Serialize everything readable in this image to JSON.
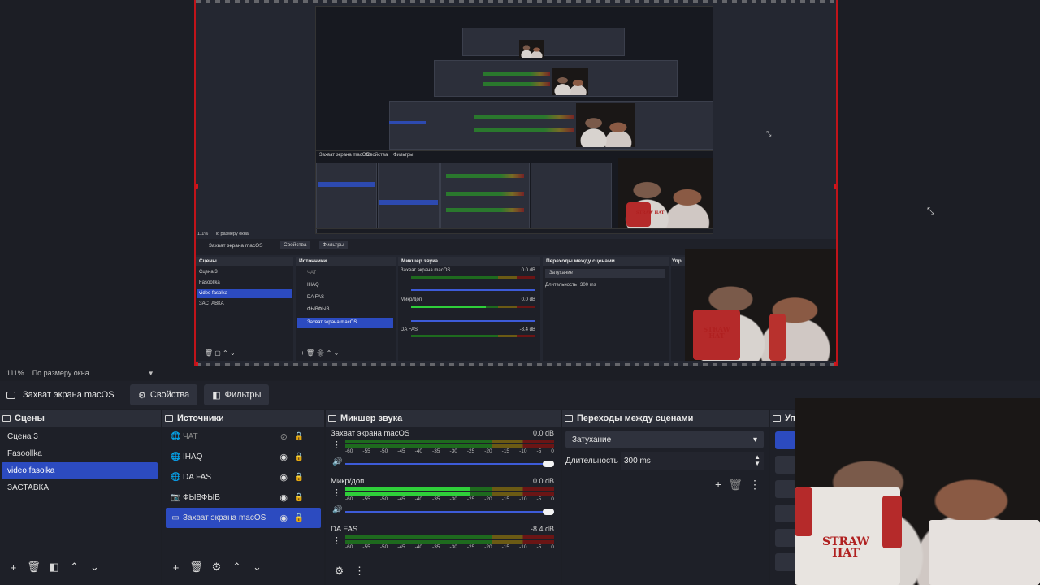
{
  "preview": {
    "nested_zoom": "111%",
    "nested_fit": "По размеру окна",
    "nested_source": "Захват экрана macOS",
    "nested_props": "Свойства",
    "nested_filters": "Фильтры",
    "nested_scenes_title": "Сцены",
    "nested_sources_title": "Источники",
    "nested_mixer_title": "Микшер звука",
    "nested_trans_title": "Переходы между сценами",
    "nested_scenes": [
      "Сцена 3",
      "Fasoollka",
      "video fasolka",
      "ЗАСТАВКА"
    ],
    "nested_sources": [
      "ЧАТ",
      "IHAQ",
      "DA FAS",
      "ФЫВФЫВ",
      "Захват экрана macOS"
    ],
    "nested_channels": [
      "Захват экрана macOS",
      "Микр/доп",
      "DA FAS"
    ],
    "nested_db": [
      "0.0 dB",
      "0.0 dB",
      "-8.4 dB"
    ],
    "nested_fade": "Затухание",
    "nested_duration_label": "Длительность",
    "nested_duration": "300 ms",
    "nested_controls_title": "Упр"
  },
  "statusbar": {
    "zoom": "111%",
    "fit_mode": "По размеру окна"
  },
  "source_toolbar": {
    "source_name": "Захват экрана macOS",
    "properties_label": "Свойства",
    "filters_label": "Фильтры"
  },
  "scenes": {
    "title": "Сцены",
    "items": [
      {
        "label": "Сцена 3",
        "selected": false
      },
      {
        "label": "Fasoollka",
        "selected": false
      },
      {
        "label": "video fasolka",
        "selected": true
      },
      {
        "label": "ЗАСТАВКА",
        "selected": false
      }
    ]
  },
  "sources": {
    "title": "Источники",
    "items": [
      {
        "label": "ЧАТ",
        "icon": "browser-icon",
        "visible": false
      },
      {
        "label": "IHAQ",
        "icon": "browser-icon",
        "visible": true
      },
      {
        "label": "DA FAS",
        "icon": "browser-icon",
        "visible": true
      },
      {
        "label": "ФЫВФЫВ",
        "icon": "camera-icon",
        "visible": true
      },
      {
        "label": "Захват экрана macOS",
        "icon": "monitor-icon",
        "visible": true,
        "selected": true
      }
    ]
  },
  "mixer": {
    "title": "Микшер звука",
    "scale": [
      "-60",
      "-55",
      "-50",
      "-45",
      "-40",
      "-35",
      "-30",
      "-25",
      "-20",
      "-15",
      "-10",
      "-5",
      "0"
    ],
    "channels": [
      {
        "name": "Захват экрана macOS",
        "db": "0.0 dB",
        "volume": 1.0
      },
      {
        "name": "Микр/доп",
        "db": "0.0 dB",
        "volume": 1.0
      },
      {
        "name": "DA FAS",
        "db": "-8.4 dB",
        "volume": 0.85
      }
    ]
  },
  "transitions": {
    "title": "Переходы между сценами",
    "selected": "Затухание",
    "duration_label": "Длительность",
    "duration": "300 ms"
  },
  "controls": {
    "title": "Упр"
  },
  "colors": {
    "accent": "#2c4bc0",
    "bounds": "#c0141a",
    "panel": "#1e2028",
    "panel_header": "#2b2e38"
  }
}
